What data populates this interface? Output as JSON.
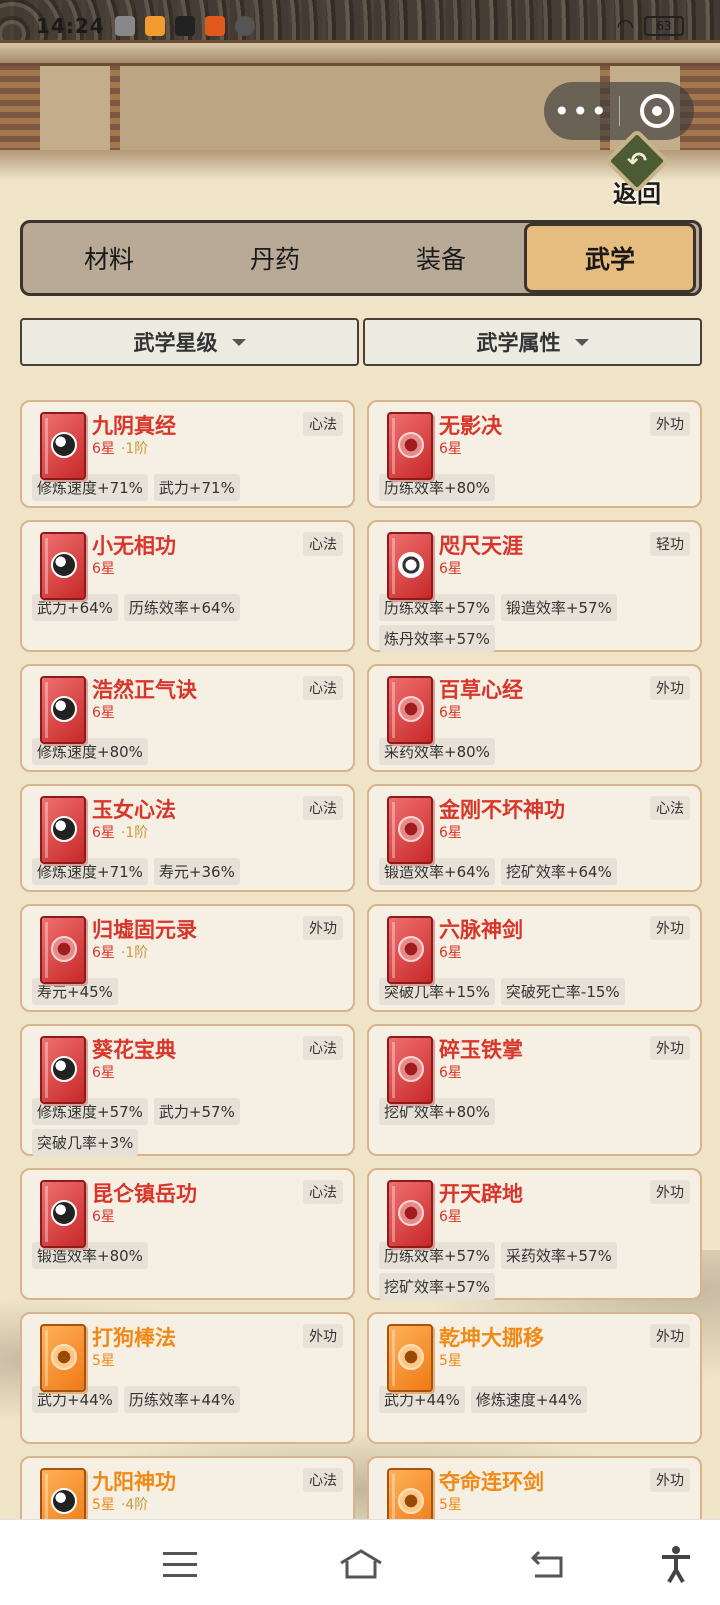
{
  "status_bar": {
    "time": "14:24",
    "battery": "63"
  },
  "capsule": {
    "more_label": "•••"
  },
  "back_button": {
    "label": "返回"
  },
  "tabs": [
    {
      "label": "材料",
      "active": false
    },
    {
      "label": "丹药",
      "active": false
    },
    {
      "label": "装备",
      "active": false
    },
    {
      "label": "武学",
      "active": true
    }
  ],
  "filters": [
    {
      "label": "武学星级"
    },
    {
      "label": "武学属性"
    }
  ],
  "cards": [
    {
      "name": "九阴真经",
      "stars": "6星",
      "level": "·1阶",
      "type": "心法",
      "rarity": "red",
      "attrs": [
        "修炼速度+71%",
        "武力+71%"
      ]
    },
    {
      "name": "无影决",
      "stars": "6星",
      "level": "",
      "type": "外功",
      "rarity": "red",
      "attrs": [
        "历练效率+80%"
      ]
    },
    {
      "name": "小无相功",
      "stars": "6星",
      "level": "",
      "type": "心法",
      "rarity": "red",
      "attrs": [
        "武力+64%",
        "历练效率+64%"
      ]
    },
    {
      "name": "咫尺天涯",
      "stars": "6星",
      "level": "",
      "type": "轻功",
      "rarity": "red",
      "attrs": [
        "历练效率+57%",
        "锻造效率+57%",
        "炼丹效率+57%"
      ]
    },
    {
      "name": "浩然正气诀",
      "stars": "6星",
      "level": "",
      "type": "心法",
      "rarity": "red",
      "attrs": [
        "修炼速度+80%"
      ]
    },
    {
      "name": "百草心经",
      "stars": "6星",
      "level": "",
      "type": "外功",
      "rarity": "red",
      "attrs": [
        "采药效率+80%"
      ]
    },
    {
      "name": "玉女心法",
      "stars": "6星",
      "level": "·1阶",
      "type": "心法",
      "rarity": "red",
      "attrs": [
        "修炼速度+71%",
        "寿元+36%"
      ]
    },
    {
      "name": "金刚不坏神功",
      "stars": "6星",
      "level": "",
      "type": "心法",
      "rarity": "red",
      "attrs": [
        "锻造效率+64%",
        "挖矿效率+64%"
      ]
    },
    {
      "name": "归墟固元录",
      "stars": "6星",
      "level": "·1阶",
      "type": "外功",
      "rarity": "red",
      "attrs": [
        "寿元+45%"
      ]
    },
    {
      "name": "六脉神剑",
      "stars": "6星",
      "level": "",
      "type": "外功",
      "rarity": "red",
      "attrs": [
        "突破几率+15%",
        "突破死亡率-15%"
      ]
    },
    {
      "name": "葵花宝典",
      "stars": "6星",
      "level": "",
      "type": "心法",
      "rarity": "red",
      "attrs": [
        "修炼速度+57%",
        "武力+57%",
        "突破几率+3%"
      ]
    },
    {
      "name": "碎玉铁掌",
      "stars": "6星",
      "level": "",
      "type": "外功",
      "rarity": "red",
      "attrs": [
        "挖矿效率+80%"
      ]
    },
    {
      "name": "昆仑镇岳功",
      "stars": "6星",
      "level": "",
      "type": "心法",
      "rarity": "red",
      "attrs": [
        "锻造效率+80%"
      ]
    },
    {
      "name": "开天辟地",
      "stars": "6星",
      "level": "",
      "type": "外功",
      "rarity": "red",
      "attrs": [
        "历练效率+57%",
        "采药效率+57%",
        "挖矿效率+57%"
      ]
    },
    {
      "name": "打狗棒法",
      "stars": "5星",
      "level": "",
      "type": "外功",
      "rarity": "orange",
      "attrs": [
        "武力+44%",
        "历练效率+44%"
      ]
    },
    {
      "name": "乾坤大挪移",
      "stars": "5星",
      "level": "",
      "type": "外功",
      "rarity": "orange",
      "attrs": [
        "武力+44%",
        "修炼速度+44%"
      ]
    },
    {
      "name": "九阳神功",
      "stars": "5星",
      "level": "·4阶",
      "type": "心法",
      "rarity": "orange",
      "attrs": []
    },
    {
      "name": "夺命连环剑",
      "stars": "5星",
      "level": "",
      "type": "外功",
      "rarity": "orange",
      "attrs": []
    }
  ]
}
